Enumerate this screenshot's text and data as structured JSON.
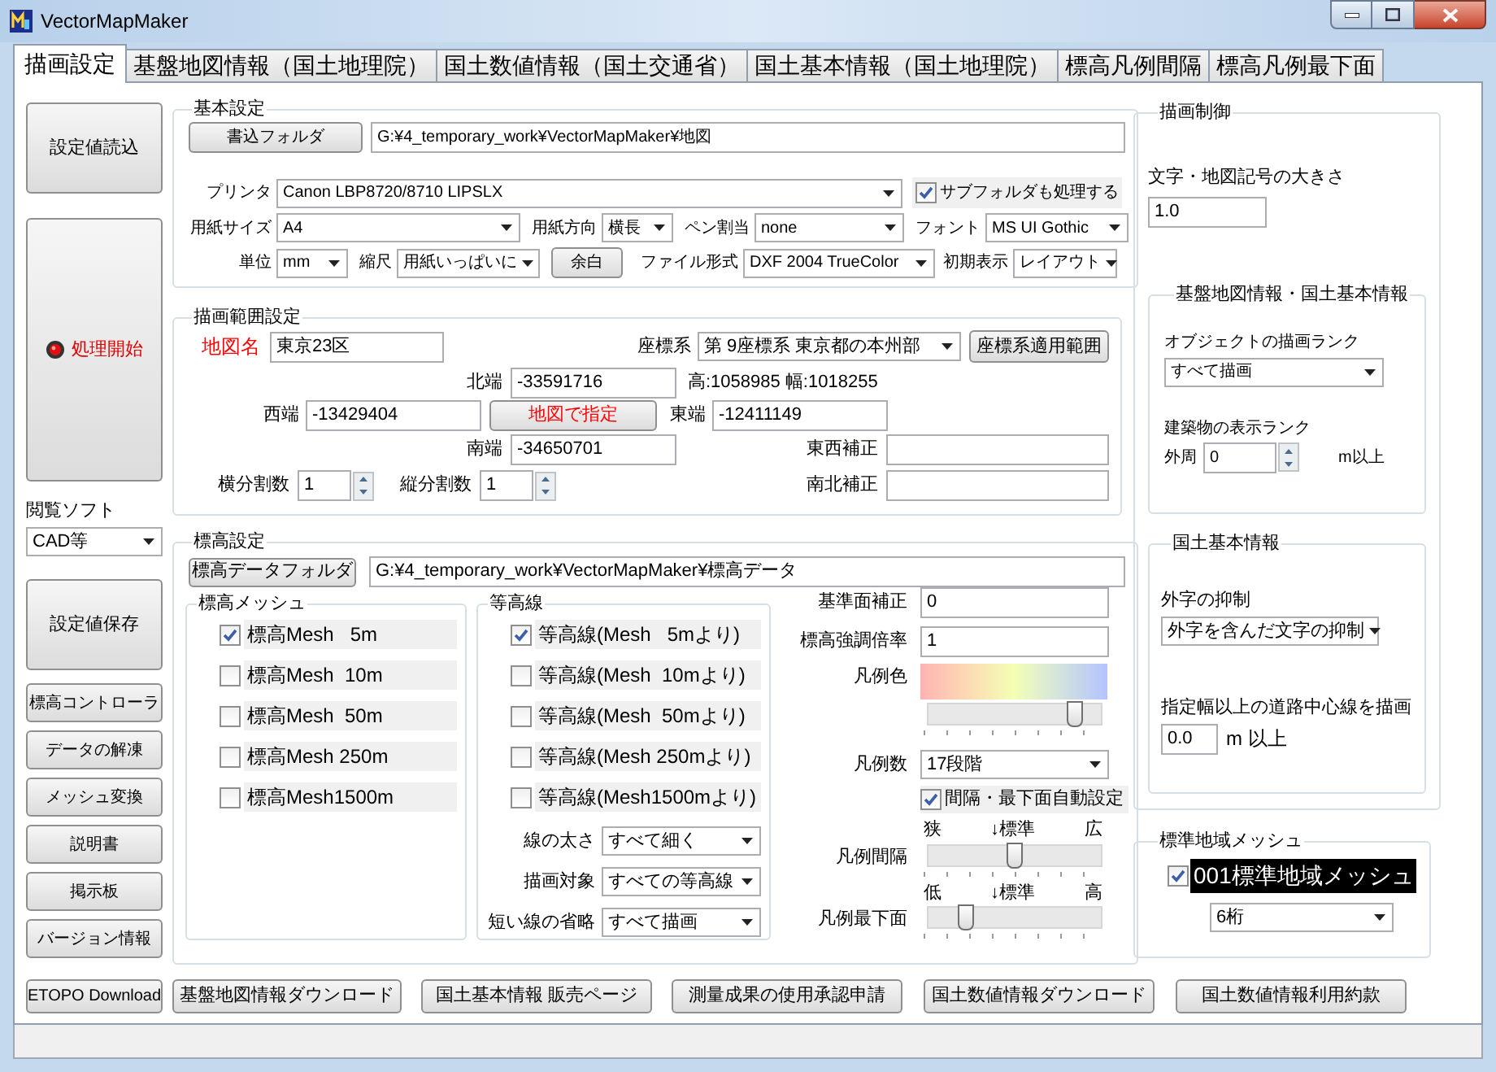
{
  "window": {
    "title": "VectorMapMaker"
  },
  "tabs": [
    {
      "label": "描画設定",
      "selected": true
    },
    {
      "label": "基盤地図情報（国土地理院）",
      "selected": false
    },
    {
      "label": "国土数値情報（国土交通省）",
      "selected": false
    },
    {
      "label": "国土基本情報（国土地理院）",
      "selected": false
    },
    {
      "label": "標高凡例間隔",
      "selected": false
    },
    {
      "label": "標高凡例最下面",
      "selected": false
    }
  ],
  "side": {
    "load_button": "設定値読込",
    "start_button": "処理開始",
    "viewer_label": "閲覧ソフト",
    "viewer": "CAD等",
    "save_button": "設定値保存",
    "tools": [
      "標高コントローラ",
      "データの解凍",
      "メッシュ変換",
      "説明書",
      "掲示板",
      "バージョン情報"
    ]
  },
  "basic": {
    "title": "基本設定",
    "folder_button": "書込フォルダ",
    "folder_path": "G:¥4_temporary_work¥VectorMapMaker¥地図",
    "printer_label": "プリンタ",
    "printer": "Canon LBP8720/8710 LIPSLX",
    "subfolder": {
      "label": "サブフォルダも処理する",
      "checked": true
    },
    "row2": [
      {
        "kind": "select",
        "label": "用紙サイズ",
        "value": "A4"
      },
      {
        "kind": "select",
        "label": "用紙方向",
        "value": "横長"
      },
      {
        "kind": "select",
        "label": "ペン割当",
        "value": "none"
      },
      {
        "kind": "select",
        "label": "フォント",
        "value": "MS UI Gothic"
      }
    ],
    "row3": [
      {
        "kind": "select",
        "label": "単位",
        "value": "mm"
      },
      {
        "kind": "select",
        "label": "縮尺",
        "value": "用紙いっぱいに"
      },
      {
        "kind": "button",
        "label": "余白"
      },
      {
        "kind": "select",
        "label": "ファイル形式",
        "value": "DXF 2004 TrueColor"
      },
      {
        "kind": "select",
        "label": "初期表示",
        "value": "レイアウト"
      }
    ]
  },
  "range": {
    "title": "描画範囲設定",
    "map_name_label": "地図名",
    "map_name": "東京23区",
    "crs_label": "座標系",
    "crs": "第 9座標系 東京都の本州部",
    "crs_button": "座標系適用範囲",
    "north_label": "北端",
    "north": "-33591716",
    "size_text": "高:1058985 幅:1018255",
    "west_label": "西端",
    "west": "-13429404",
    "map_button": "地図で指定",
    "east_label": "東端",
    "east": "-12411149",
    "south_label": "南端",
    "south": "-34650701",
    "ew_label": "東西補正",
    "ns_label": "南北補正",
    "h_div_label": "横分割数",
    "h_div": "1",
    "v_div_label": "縦分割数",
    "v_div": "1"
  },
  "elevation": {
    "title": "標高設定",
    "folder_button": "標高データフォルダ",
    "folder_path": "G:¥4_temporary_work¥VectorMapMaker¥標高データ",
    "mesh": {
      "title": "標高メッシュ",
      "items": [
        {
          "label": "標高Mesh   5m",
          "checked": true
        },
        {
          "label": "標高Mesh  10m",
          "checked": false
        },
        {
          "label": "標高Mesh  50m",
          "checked": false
        },
        {
          "label": "標高Mesh 250m",
          "checked": false
        },
        {
          "label": "標高Mesh1500m",
          "checked": false
        }
      ]
    },
    "contours": {
      "title": "等高線",
      "items": [
        {
          "label": "等高線(Mesh   5mより)",
          "checked": true
        },
        {
          "label": "等高線(Mesh  10mより)",
          "checked": false
        },
        {
          "label": "等高線(Mesh  50mより)",
          "checked": false
        },
        {
          "label": "等高線(Mesh 250mより)",
          "checked": false
        },
        {
          "label": "等高線(Mesh1500mより)",
          "checked": false
        }
      ],
      "fields": [
        {
          "label": "線の太さ",
          "value": "すべて細く"
        },
        {
          "label": "描画対象",
          "value": "すべての等高線"
        },
        {
          "label": "短い線の省略",
          "value": "すべて描画"
        }
      ]
    },
    "base_offset": {
      "label": "基準面補正",
      "value": "0"
    },
    "exaggeration": {
      "label": "標高強調倍率",
      "value": "1"
    },
    "legend_color": {
      "label": "凡例色",
      "level": 0.85
    },
    "legend_count": {
      "label": "凡例数",
      "value": "17段階"
    },
    "auto": {
      "label": "間隔・最下面自動設定",
      "checked": true
    },
    "interval": {
      "label": "凡例間隔",
      "low": "狭",
      "mid": "↓標準",
      "high": "広",
      "level": 0.5
    },
    "lowest": {
      "label": "凡例最下面",
      "low": "低",
      "mid": "↓標準",
      "high": "高",
      "level": 0.22
    }
  },
  "control": {
    "title": "描画制御",
    "size_label": "文字・地図記号の大きさ",
    "size": "1.0",
    "base": {
      "title": "基盤地図情報・国土基本情報",
      "rank_label": "オブジェクトの描画ランク",
      "rank": "すべて描画",
      "building_label": "建築物の表示ランク",
      "perimeter_label": "外周",
      "perimeter": "0",
      "unit": "m以上"
    },
    "kokudo": {
      "title": "国土基本情報",
      "gaiji_label": "外字の抑制",
      "gaiji": "外字を含んだ文字の抑制",
      "road_label": "指定幅以上の道路中心線を描画",
      "road": "0.0",
      "road_unit": "m 以上"
    }
  },
  "mesh_group": {
    "title": "標準地域メッシュ",
    "checkbox": {
      "label": "001標準地域メッシュ",
      "checked": true,
      "focused": true
    },
    "digits": "6桁"
  },
  "bottom_buttons": [
    "ETOPO Download",
    "基盤地図情報ダウンロード",
    "国土基本情報 販売ページ",
    "測量成果の使用承認申請",
    "国土数値情報ダウンロード",
    "国土数値情報利用約款"
  ]
}
